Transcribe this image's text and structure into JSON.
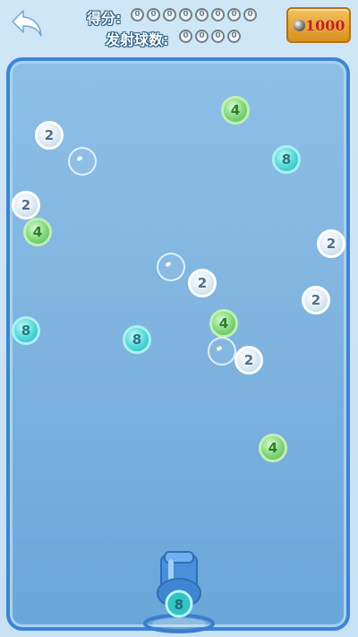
{
  "hud": {
    "score_label": "得分:",
    "score_digits": [
      "0",
      "0",
      "0",
      "0",
      "0",
      "0",
      "0",
      "0"
    ],
    "shots_label": "发射球数:",
    "shots_digits": [
      "0",
      "0",
      "0",
      "0"
    ],
    "coins": "1000",
    "back_icon": "back-arrow-icon",
    "coin_icon": "steel-ball-icon"
  },
  "bubbles": [
    {
      "value": "2",
      "type": "b2"
    },
    {
      "value": "4",
      "type": "b4"
    },
    {
      "value": "8",
      "type": "b8"
    },
    {
      "value": "2",
      "type": "b2"
    },
    {
      "value": "4",
      "type": "b4"
    },
    {
      "value": "2",
      "type": "b2"
    },
    {
      "value": "2",
      "type": "b2"
    },
    {
      "value": "2",
      "type": "b2"
    },
    {
      "value": "8",
      "type": "b8"
    },
    {
      "value": "8",
      "type": "b8"
    },
    {
      "value": "4",
      "type": "b4"
    },
    {
      "value": "2",
      "type": "b2"
    },
    {
      "value": "4",
      "type": "b4"
    }
  ],
  "cannon": {
    "loaded_value": "8"
  },
  "colors": {
    "accent": "#3e86d4",
    "coin_text": "#c51e1e"
  }
}
